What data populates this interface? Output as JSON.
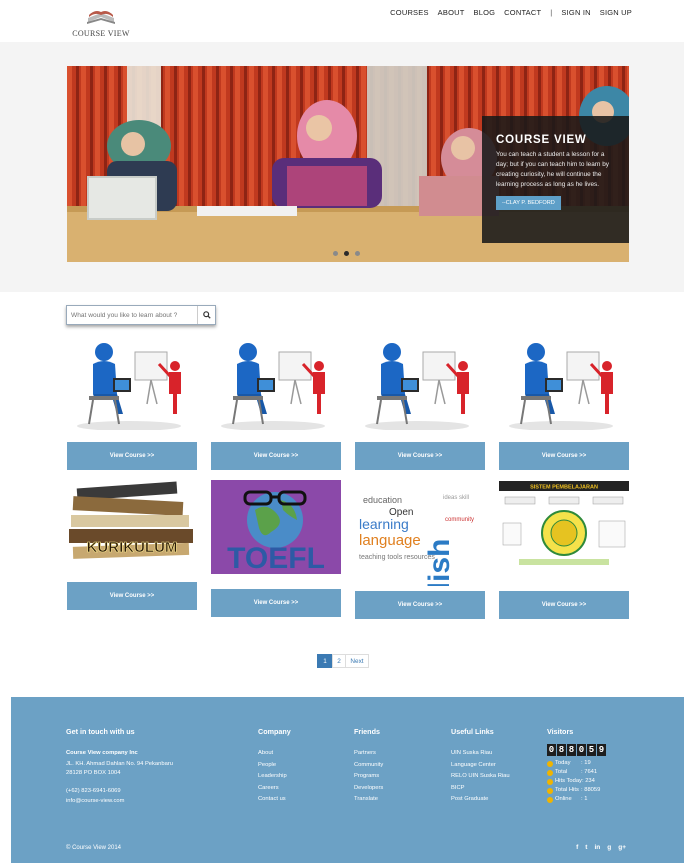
{
  "brand": {
    "name": "Course View"
  },
  "nav": {
    "courses": "COURSES",
    "about": "ABOUT",
    "blog": "BLOG",
    "contact": "CONTACT",
    "separator": "|",
    "sign_in": "SIGN IN",
    "sign_up": "SIGN UP"
  },
  "hero": {
    "caption_title": "COURSE VIEW",
    "caption_text": "You can teach a student a lesson for a day; but if you can teach him to learn by creating curiosity, he will continue the learning process as long as he lives.",
    "caption_author": "--CLAY P. BEDFORD",
    "slide_count": 3,
    "active_slide": 2
  },
  "search": {
    "placeholder": "What would you like to learn about ?",
    "icon": "search-icon"
  },
  "courses": {
    "view_label": "View Course >>",
    "images": [
      "presentation-figure",
      "presentation-figure",
      "presentation-figure",
      "presentation-figure",
      "KURIKULUM",
      "TOEFL",
      "English",
      "SISTEM PEMBELAJARAN"
    ]
  },
  "pagination": {
    "page1": "1",
    "page2": "2",
    "next": "Next"
  },
  "footer": {
    "contact": {
      "title": "Get in touch with us",
      "company": "Course View company Inc",
      "address1": "JL. KH. Ahmad Dahlan No. 94 Pekanbaru",
      "address2": "28128 PO BOX 1004",
      "phone": "(+62) 823-6941-6069",
      "email": "info@course-view.com"
    },
    "company": {
      "title": "Company",
      "items": [
        "About",
        "People",
        "Leadership",
        "Careers",
        "Contact us"
      ]
    },
    "friends": {
      "title": "Friends",
      "items": [
        "Partners",
        "Community",
        "Programs",
        "Developers",
        "Translate"
      ]
    },
    "links": {
      "title": "Useful Links",
      "items": [
        "UIN Suska Riau",
        "Language Center",
        "RELO UIN Suska Riau",
        "BICP",
        "Post Graduate"
      ]
    },
    "visitors": {
      "title": "Visitors",
      "digits": [
        "0",
        "8",
        "8",
        "0",
        "5",
        "9"
      ],
      "stats": [
        {
          "label": "Today",
          "value": ": 19"
        },
        {
          "label": "Total",
          "value": ": 7641"
        },
        {
          "label": "Hits Today",
          "value": ": 234"
        },
        {
          "label": "Total Hits",
          "value": ": 88059"
        },
        {
          "label": "Online",
          "value": ": 1"
        }
      ]
    },
    "copyright": "© Course View 2014",
    "social": [
      "f",
      "t",
      "in",
      "g",
      "g+"
    ]
  },
  "colors": {
    "accent": "#6ca1c5",
    "accent_dark": "#3b7ab3",
    "caption_bg": "#191919"
  }
}
